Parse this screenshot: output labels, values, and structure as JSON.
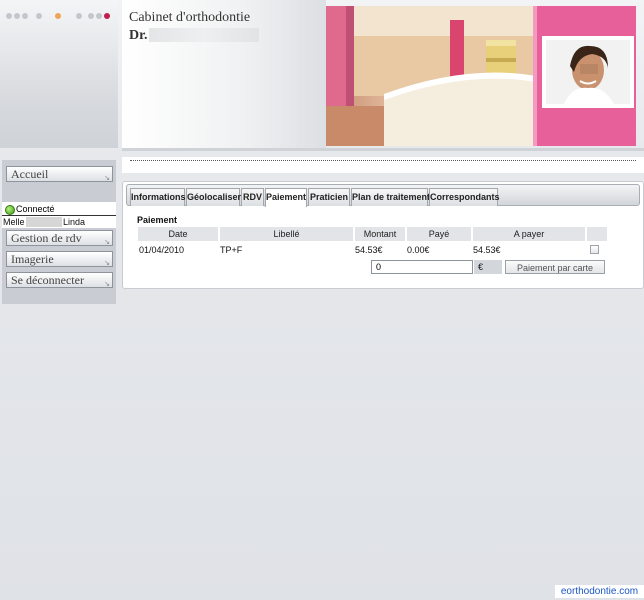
{
  "header": {
    "dots": [
      "#c3c6cb",
      "#c3c6cb",
      "#c3c6cb",
      "#c3c6cb",
      "#f0a35a",
      "#c3c6cb",
      "#c3c6cb",
      "#c3c6cb",
      "#c41e4a"
    ],
    "cabinet_title": "Cabinet d'orthodontie",
    "doctor_prefix": "Dr."
  },
  "sidebar": {
    "accueil": "Accueil",
    "connected_label": "Connecté",
    "user_title": "Melle",
    "user_name": "Linda",
    "items": [
      "Gestion de rdv",
      "Imagerie",
      "Se déconnecter"
    ]
  },
  "tabs": [
    "Informations",
    "Géolocaliser",
    "RDV",
    "Paiement",
    "Praticien",
    "Plan de traitement",
    "Correspondants"
  ],
  "active_tab": "Paiement",
  "payment": {
    "section_title": "Paiement",
    "columns": [
      "Date",
      "Libellé",
      "Montant",
      "Payé",
      "A payer"
    ],
    "rows": [
      {
        "date": "01/04/2010",
        "libelle": "TP+F",
        "montant": "54.53€",
        "paye": "0.00€",
        "a_payer": "54.53€"
      }
    ],
    "amount_value": "0",
    "currency": "€",
    "pay_button": "Paiement par carte"
  },
  "footer": {
    "brand": "eorthodontie.com"
  },
  "colors": {
    "accent_pink": "#e8609a",
    "connected_green": "#3e9a1c",
    "link_blue": "#1a56c4"
  }
}
